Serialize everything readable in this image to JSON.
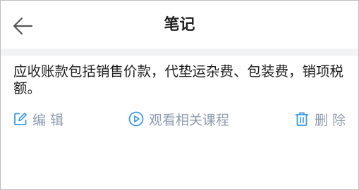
{
  "header": {
    "title": "笔记",
    "back_icon": "arrow-left-icon"
  },
  "note": {
    "content": "应收账款包括销售价款，代垫运杂费、包装费，销项税额。"
  },
  "actions": {
    "edit_label": "编辑",
    "edit_icon": "edit-icon",
    "course_label": "观看相关课程",
    "course_icon": "play-circle-icon",
    "delete_label": "删除",
    "delete_icon": "trash-icon"
  },
  "colors": {
    "edit_icon": "#3a9ae8",
    "action_text": "#8f9bb0",
    "separator": "#f2f3f5"
  }
}
